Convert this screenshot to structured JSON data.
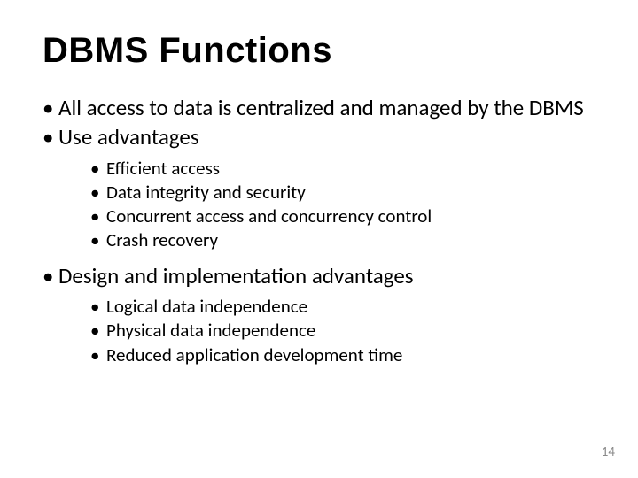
{
  "title": "DBMS  Functions",
  "bullets": [
    {
      "text": "All access to data is centralized and managed by the DBMS"
    },
    {
      "text": "Use advantages",
      "children": [
        "Efficient access",
        "Data integrity and security",
        "Concurrent access and concurrency control",
        "Crash recovery"
      ]
    },
    {
      "text": "Design and implementation advantages",
      "children": [
        "Logical data independence",
        "Physical data independence",
        "Reduced application development time"
      ]
    }
  ],
  "page_number": "14"
}
